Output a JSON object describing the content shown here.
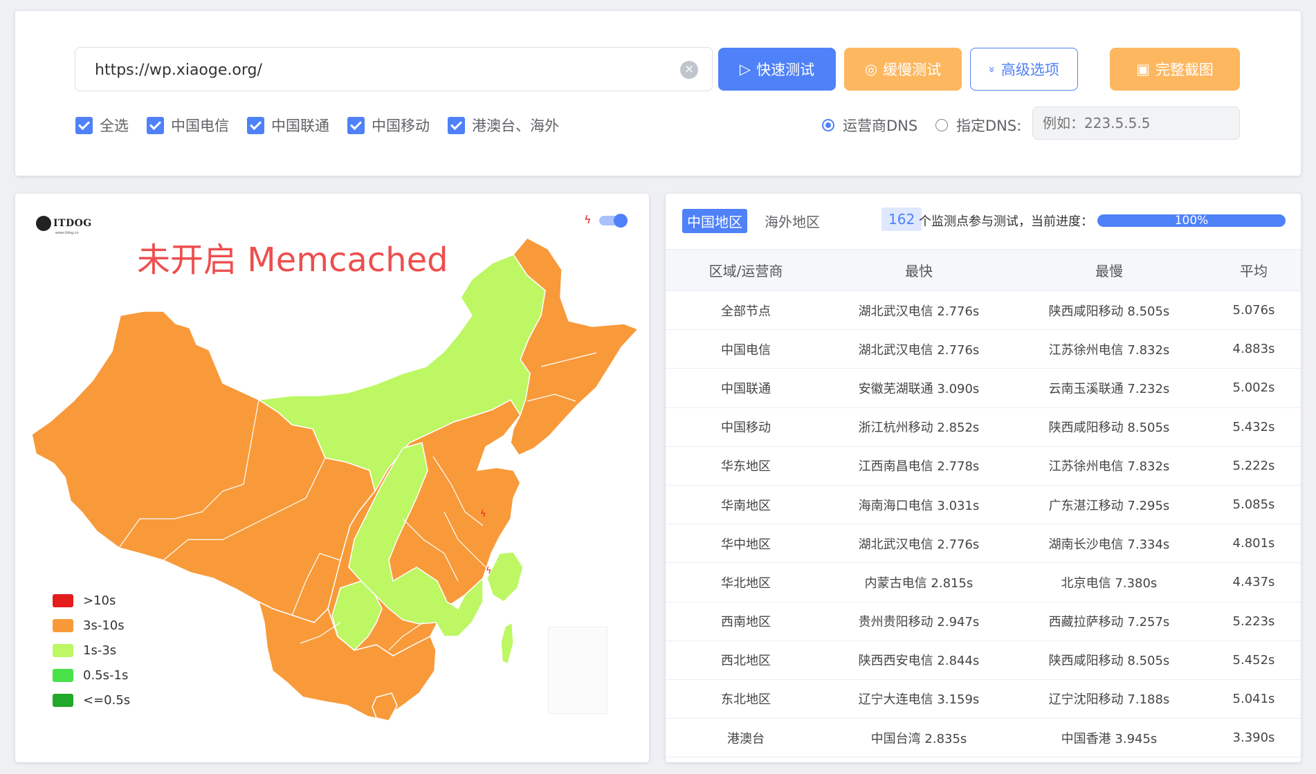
{
  "search": {
    "url_value": "https://wp.xiaoge.org/",
    "clear_icon": "×"
  },
  "buttons": {
    "fast": {
      "label": "快速测试",
      "icon": "▷"
    },
    "slow": {
      "label": "缓慢测试",
      "icon": "◎"
    },
    "advanced": {
      "label": "高级选项",
      "icon": "»"
    },
    "screenshot": {
      "label": "完整截图",
      "icon": "▣"
    }
  },
  "filters": {
    "select_all": "全选",
    "telecom": "中国电信",
    "unicom": "中国联通",
    "mobile": "中国移动",
    "overseas": "港澳台、海外"
  },
  "dns": {
    "isp_label": "运营商DNS",
    "custom_label": "指定DNS:",
    "placeholder": "例如：223.5.5.5"
  },
  "map": {
    "logo_text": "ITDOG",
    "logo_sub": "www.itdog.cn",
    "title": "未开启 Memcached",
    "legend": [
      {
        "label": ">10s",
        "color": "#e51c1c"
      },
      {
        "label": "3s-10s",
        "color": "#f89a3a"
      },
      {
        "label": "1s-3s",
        "color": "#bdf763"
      },
      {
        "label": "0.5s-1s",
        "color": "#48e248"
      },
      {
        "label": "<=0.5s",
        "color": "#22a82a"
      }
    ]
  },
  "results": {
    "tab_china": "中国地区",
    "tab_overseas": "海外地区",
    "node_count": "162",
    "count_text": "个监测点参与测试，当前进度：",
    "progress_label": "100%",
    "progress_value": 100,
    "headers": [
      "区域/运营商",
      "最快",
      "最慢",
      "平均"
    ],
    "rows": [
      [
        "全部节点",
        "湖北武汉电信 2.776s",
        "陕西咸阳移动 8.505s",
        "5.076s"
      ],
      [
        "中国电信",
        "湖北武汉电信 2.776s",
        "江苏徐州电信 7.832s",
        "4.883s"
      ],
      [
        "中国联通",
        "安徽芜湖联通 3.090s",
        "云南玉溪联通 7.232s",
        "5.002s"
      ],
      [
        "中国移动",
        "浙江杭州移动 2.852s",
        "陕西咸阳移动 8.505s",
        "5.432s"
      ],
      [
        "华东地区",
        "江西南昌电信 2.778s",
        "江苏徐州电信 7.832s",
        "5.222s"
      ],
      [
        "华南地区",
        "海南海口电信 3.031s",
        "广东湛江移动 7.295s",
        "5.085s"
      ],
      [
        "华中地区",
        "湖北武汉电信 2.776s",
        "湖南长沙电信 7.334s",
        "4.801s"
      ],
      [
        "华北地区",
        "内蒙古电信 2.815s",
        "北京电信 7.380s",
        "4.437s"
      ],
      [
        "西南地区",
        "贵州贵阳移动 2.947s",
        "西藏拉萨移动 7.257s",
        "5.223s"
      ],
      [
        "西北地区",
        "陕西西安电信 2.844s",
        "陕西咸阳移动 8.505s",
        "5.452s"
      ],
      [
        "东北地区",
        "辽宁大连电信 3.159s",
        "辽宁沈阳移动 7.188s",
        "5.041s"
      ],
      [
        "港澳台",
        "中国台湾 2.835s",
        "中国香港 3.945s",
        "3.390s"
      ]
    ]
  }
}
